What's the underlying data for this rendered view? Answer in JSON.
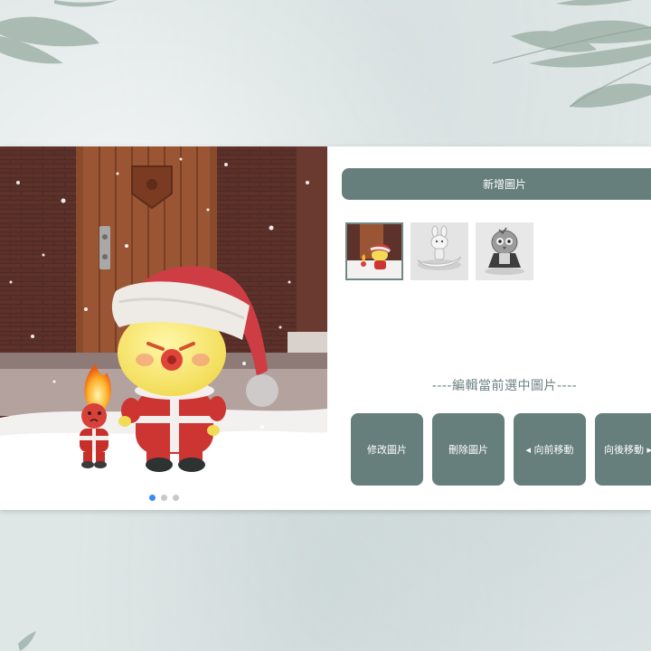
{
  "editor": {
    "add_button_label": "新增圖片",
    "section_title": "----編輯當前選中圖片----",
    "actions": [
      {
        "label": "修改圖片"
      },
      {
        "label": "刪除圖片"
      },
      {
        "label": "◂ 向前移動"
      },
      {
        "label": "向後移動 ▸"
      }
    ]
  },
  "slider": {
    "slide_count": 3,
    "active_index": 0
  },
  "thumbnails": [
    {
      "icon": "christmas-toy-photo-thumbnail",
      "selected": true
    },
    {
      "icon": "white-bunny-figure-thumbnail",
      "selected": false
    },
    {
      "icon": "bird-figure-thumbnail",
      "selected": false
    }
  ],
  "colors": {
    "button_bg": "#667f7c",
    "button_text": "#ffffff",
    "section_title": "#6c8281",
    "dot_active": "#3b8af5",
    "dot_inactive": "#c8c8c8",
    "page_bg": "#dfe6e6"
  }
}
